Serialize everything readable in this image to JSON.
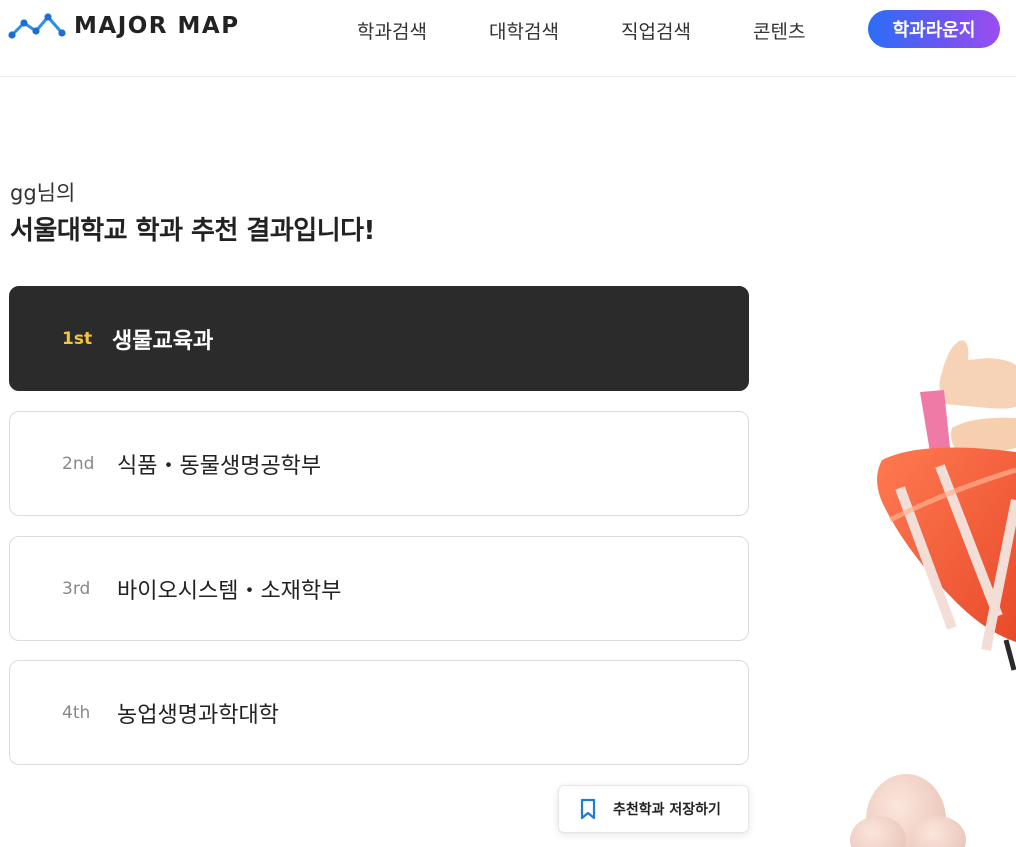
{
  "header": {
    "logo_text": "MAJOR MAP",
    "nav": [
      "학과검색",
      "대학검색",
      "직업검색",
      "콘텐츠"
    ],
    "lounge_button": "학과라운지",
    "accent_gradient": [
      "#2b6ef5",
      "#9b4ef0"
    ]
  },
  "greeting": {
    "user": "gg님의",
    "title": "서울대학교 학과 추천 결과입니다!"
  },
  "recommendations": [
    {
      "rank": "1st",
      "major": "생물교육과"
    },
    {
      "rank": "2nd",
      "major": "식품・동물생명공학부"
    },
    {
      "rank": "3rd",
      "major": "바이오시스템・소재학부"
    },
    {
      "rank": "4th",
      "major": "농업생명과학대학"
    }
  ],
  "save_button": {
    "label": "추천학과 저장하기",
    "icon": "bookmark-icon"
  },
  "colors": {
    "first_card_bg": "#2b2b2b",
    "first_rank": "#f3c443",
    "bookmark": "#1f7bd8"
  }
}
